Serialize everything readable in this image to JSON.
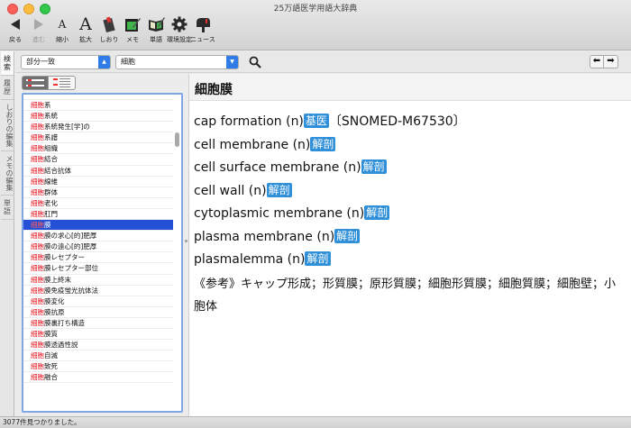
{
  "window": {
    "title": "25万語医学用語大辞典"
  },
  "toolbar": [
    {
      "label": "戻る",
      "icon": "back-arrow-icon",
      "disabled": false
    },
    {
      "label": "進む",
      "icon": "forward-arrow-icon",
      "disabled": true
    },
    {
      "label": "縮小",
      "icon": "font-smaller-icon",
      "disabled": false
    },
    {
      "label": "拡大",
      "icon": "font-larger-icon",
      "disabled": false
    },
    {
      "label": "しおり",
      "icon": "bookmark-icon",
      "disabled": false
    },
    {
      "label": "メモ",
      "icon": "memo-icon",
      "disabled": false
    },
    {
      "label": "単語",
      "icon": "wordbook-icon",
      "disabled": false
    },
    {
      "label": "環境設定",
      "icon": "gear-icon",
      "disabled": false
    },
    {
      "label": "ニュース",
      "icon": "mailbox-icon",
      "disabled": false
    }
  ],
  "side_tabs": [
    "検",
    "索",
    "履",
    "歴",
    "しおりの編集",
    "メモの編集",
    "単",
    "語"
  ],
  "search": {
    "mode": "部分一致",
    "query": "細胞"
  },
  "list": {
    "highlight": "細胞",
    "items": [
      "系",
      "系統",
      "系統発生[学]の",
      "系譜",
      "組織",
      "結合",
      "結合抗体",
      "線維",
      "群体",
      "老化",
      "肛門",
      "膜",
      "膜の求心[的]肥厚",
      "膜の遠心[的]肥厚",
      "膜レセプター",
      "膜レセプター部位",
      "膜上終末",
      "膜免疫蛍光抗体法",
      "膜変化",
      "膜抗原",
      "膜裏打ち構造",
      "膜質",
      "膜透過性説",
      "自滅",
      "致死",
      "融合"
    ],
    "selected_index": 11
  },
  "content": {
    "headword": "細胞膜",
    "entries": [
      {
        "term": "cap formation (n)",
        "tag": "基医",
        "extra": "〔SNOMED-M67530〕"
      },
      {
        "term": "cell membrane (n)",
        "tag": "解剖",
        "extra": ""
      },
      {
        "term": "cell surface membrane (n)",
        "tag": "解剖",
        "extra": ""
      },
      {
        "term": "cell wall (n)",
        "tag": "解剖",
        "extra": ""
      },
      {
        "term": "cytoplasmic membrane (n)",
        "tag": "解剖",
        "extra": ""
      },
      {
        "term": "plasma membrane (n)",
        "tag": "解剖",
        "extra": ""
      },
      {
        "term": "plasmalemma (n)",
        "tag": "解剖",
        "extra": ""
      }
    ],
    "reference": "《参考》キャップ形成；形質膜；原形質膜；細胞形質膜；細胞質膜；細胞壁；小胞体"
  },
  "status": "3077件見つかりました。",
  "colors": {
    "accent": "#2f8fd8",
    "selection": "#2550d6",
    "highlight": "#e8141f"
  }
}
